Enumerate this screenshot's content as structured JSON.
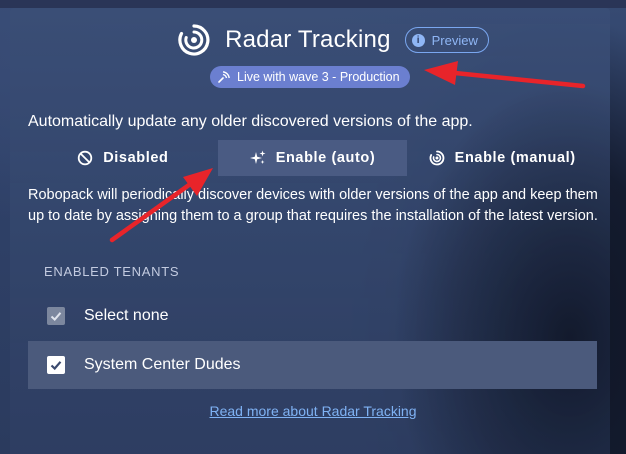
{
  "header": {
    "title": "Radar Tracking",
    "preview_label": "Preview",
    "live_badge": "Live with wave 3 - Production",
    "logo_icon": "radar-logo-icon"
  },
  "auto_update": {
    "description": "Automatically update any older discovered versions of the app.",
    "modes": [
      {
        "label": "Disabled",
        "icon": "ban-icon",
        "active": false
      },
      {
        "label": "Enable (auto)",
        "icon": "sparkle-icon",
        "active": true
      },
      {
        "label": "Enable (manual)",
        "icon": "radar-icon",
        "active": false
      }
    ],
    "explanation": "Robopack will periodically discover devices with older versions of the app and keep them up to date by assigning them to a group that requires the installation of the latest version."
  },
  "tenants": {
    "section_label": "ENABLED TENANTS",
    "items": [
      {
        "label": "Select none",
        "checked": true,
        "style": "dimmed"
      },
      {
        "label": "System Center Dudes",
        "checked": true,
        "style": "highlighted"
      }
    ]
  },
  "footer": {
    "read_more_link": "Read more about Radar Tracking"
  },
  "colors": {
    "panel": "#3a4e76",
    "badge": "#6b7fd0",
    "link": "#7fb2f4",
    "annotation_arrow": "#e8242a"
  }
}
